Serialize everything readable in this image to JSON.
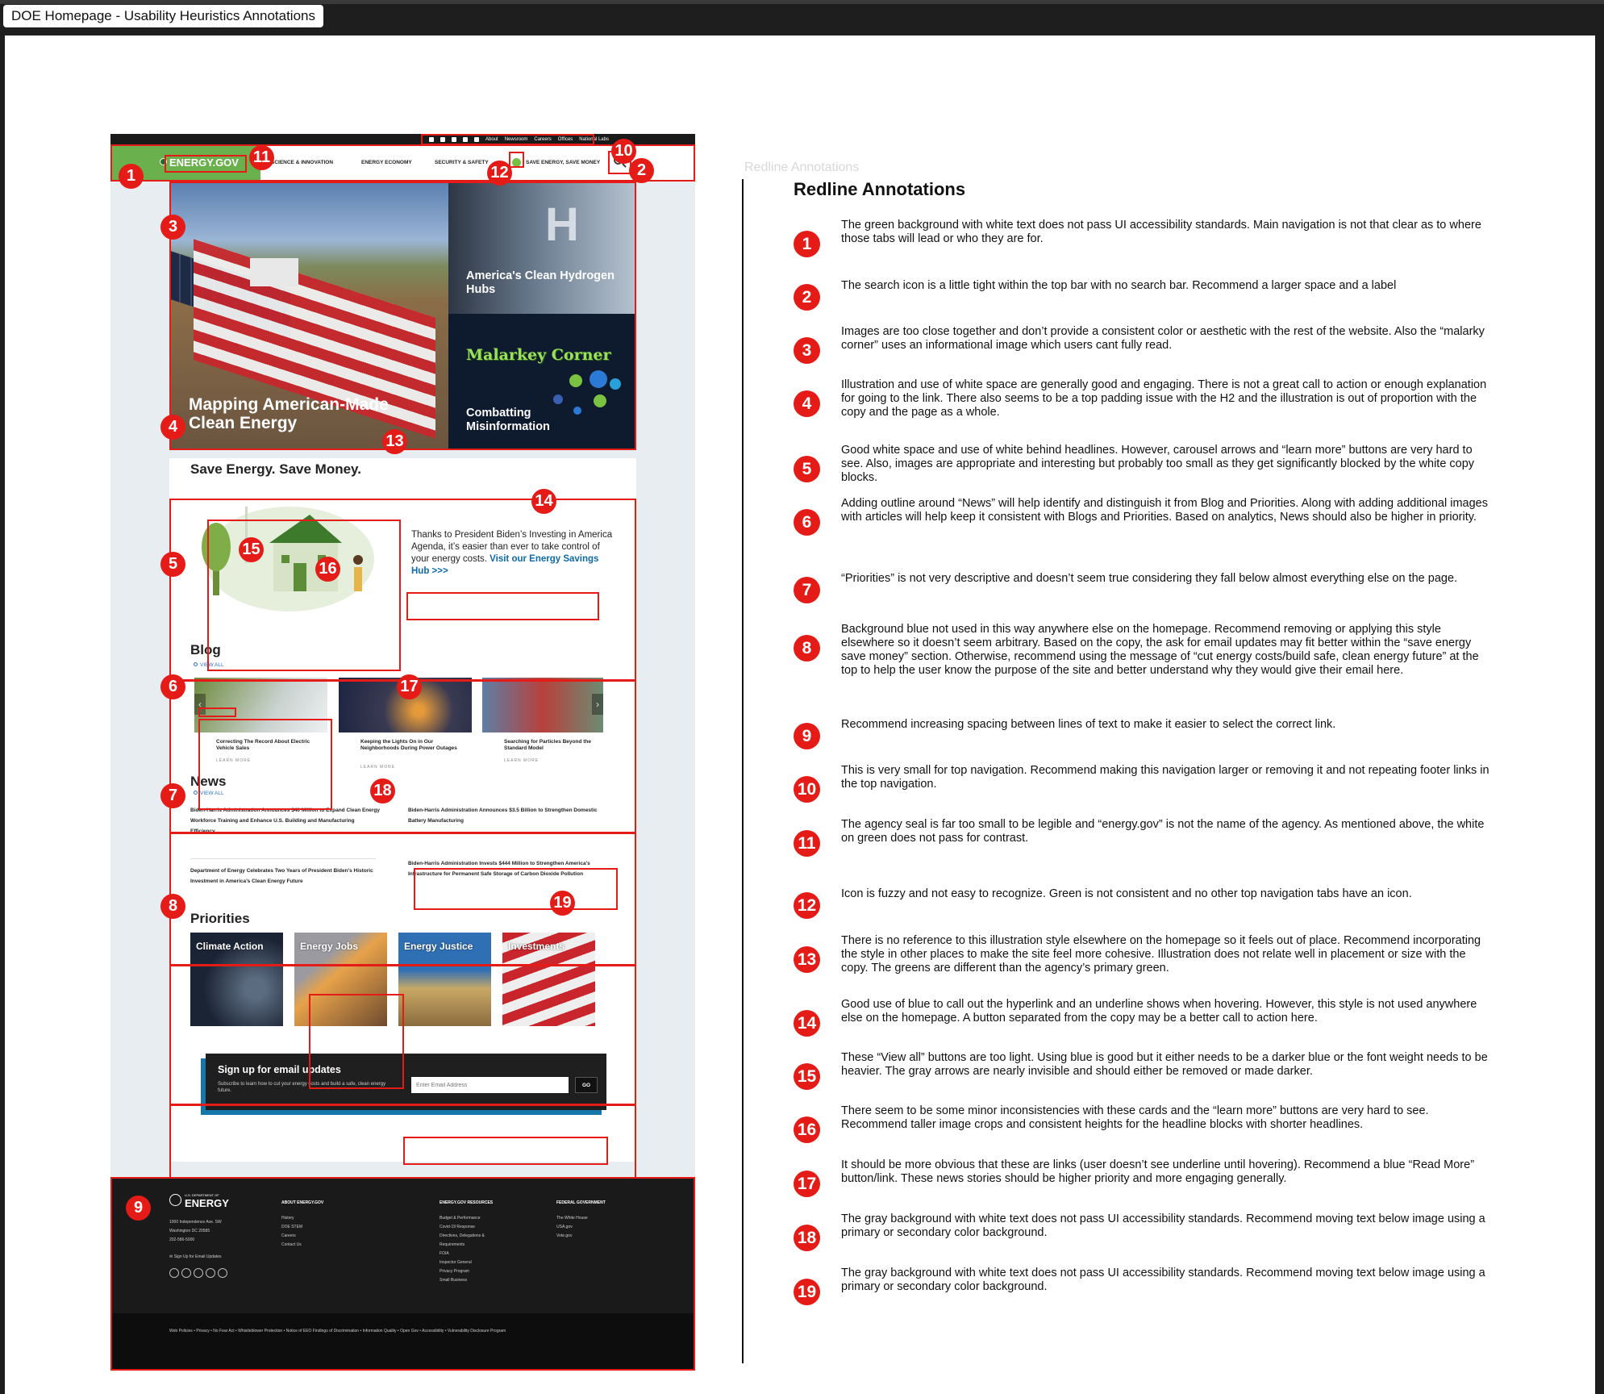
{
  "frame_title": "DOE Homepage - Usability Heuristics Annotations",
  "homepage": {
    "utility_links": [
      "About",
      "Newsroom",
      "Careers",
      "Offices",
      "National Labs"
    ],
    "social_icons": [
      "facebook-icon",
      "twitter-icon",
      "youtube-icon",
      "instagram-icon",
      "linkedin-icon"
    ],
    "logo": "ENERGY.GOV",
    "nav": [
      "SCIENCE & INNOVATION",
      "ENERGY ECONOMY",
      "SECURITY & SAFETY",
      "SAVE ENERGY, SAVE MONEY"
    ],
    "hero": {
      "main_caption": "Mapping American-Made Clean Energy",
      "h2_mark": "H",
      "h2_caption": "America's Clean Hydrogen Hubs",
      "malarkey_logo": "Malarkey Corner",
      "malarkey_caption": "Combatting Misinformation"
    },
    "save": {
      "title": "Save Energy. Save Money.",
      "text": "Thanks to President Biden’s Investing in America Agenda, it’s easier than ever to take control of your energy costs.",
      "link": "Visit our Energy Savings Hub >>>"
    },
    "blog": {
      "title": "Blog",
      "view_all": "VIEW ALL",
      "learn_more": "LEARN MORE",
      "cards": [
        {
          "title": "Correcting The Record About Electric Vehicle Sales"
        },
        {
          "title": "Keeping the Lights On in Our Neighborhoods During Power Outages"
        },
        {
          "title": "Searching for Particles Beyond the Standard Model"
        }
      ]
    },
    "news": {
      "title": "News",
      "view_all": "VIEW ALL",
      "items": [
        "Biden-Harris Administration Announces $40 Million to Expand Clean Energy Workforce Training and Enhance U.S. Building and Manufacturing Efficiency",
        "Department of Energy Celebrates Two Years of President Biden’s Historic Investment in America’s Clean Energy Future",
        "Biden-Harris Administration Announces $3.5 Billion to Strengthen Domestic Battery Manufacturing",
        "Biden-Harris Administration Invests $444 Million to Strengthen America’s Infrastructure for Permanent Safe Storage of Carbon Dioxide Pollution"
      ]
    },
    "priorities": {
      "title": "Priorities",
      "items": [
        "Climate Action",
        "Energy Jobs",
        "Energy Justice",
        "Investments"
      ]
    },
    "email": {
      "title": "Sign up for email updates",
      "subtitle": "Subscribe to learn how to cut your energy costs and build a safe, clean energy future.",
      "placeholder": "Enter Email Address",
      "button": "GO"
    },
    "footer": {
      "dept": "U.S. DEPARTMENT OF",
      "energy": "ENERGY",
      "address": [
        "1000 Independence Ave. SW",
        "Washington DC 20585",
        "202-586-5000"
      ],
      "signup": "Sign Up for Email Updates",
      "cols": [
        {
          "title": "ABOUT ENERGY.GOV",
          "items": [
            "History",
            "DOE STEM",
            "Careers",
            "Contact Us"
          ]
        },
        {
          "title": "ENERGY.GOV RESOURCES",
          "items": [
            "Budget & Performance",
            "Covid-19 Response",
            "Directives, Delegations &",
            "Requirements",
            "FOIA",
            "Inspector General",
            "Privacy Program",
            "Small Business"
          ]
        },
        {
          "title": "FEDERAL GOVERNMENT",
          "items": [
            "The White House",
            "USA.gov",
            "Vote.gov"
          ]
        }
      ],
      "legal": "Web Policies  •  Privacy  •  No Fear Act  •  Whistleblower Protection  •  Notice of EEO Findings of Discrimination  •  Information Quality  •  Open Gov  •  Accessibility  •  Vulnerability Disclosure Program"
    }
  },
  "annotations": {
    "ghost_label": "Redline Annotations",
    "title": "Redline Annotations",
    "items": [
      {
        "num": "1",
        "text": "The green background with white text does not pass UI accessibility standards. Main navigation is not that clear as to where those tabs will lead or who they are for."
      },
      {
        "num": "2",
        "text": "The search icon is a little tight within the top bar with no search bar. Recommend a larger space and a label"
      },
      {
        "num": "3",
        "text": "Images are too close together and don’t provide a consistent color or aesthetic  with the rest of the website. Also the “malarky corner” uses an informational image which users cant fully read."
      },
      {
        "num": "4",
        "text": "Illustration and use of white space are generally good and engaging. There is not a great call to action or enough explanation for going to the link. There also seems to be a top padding issue with the H2 and the illustration is out of proportion with the copy and the page as a whole."
      },
      {
        "num": "5",
        "text": "Good white space and use of white behind headlines. However, carousel arrows and “learn more” buttons are very hard to see. Also, images are appropriate and interesting but probably too small as they get significantly blocked by the white copy blocks."
      },
      {
        "num": "6",
        "text": "Adding outline around “News” will help identify and distinguish it from Blog and Priorities. Along with adding additional images with articles will help keep it consistent with Blogs and Priorities. Based on analytics, News should also be higher in priority."
      },
      {
        "num": "7",
        "text": "“Priorities” is not very descriptive and doesn’t seem true considering they fall below almost everything else on the page."
      },
      {
        "num": "8",
        "text": "Background blue not used in this way anywhere else on the homepage. Recommend removing or applying this style elsewhere so it doesn’t seem arbitrary. Based on the copy, the ask for email updates may fit better within the “save energy save money” section. Otherwise, recommend using the message of “cut energy costs/build safe, clean energy future” at the top to help the user know the purpose of the site and better understand why they would give their email here."
      },
      {
        "num": "9",
        "text": "Recommend increasing spacing between lines of text to make it easier to select the correct link."
      },
      {
        "num": "10",
        "text": "This is very small for top navigation. Recommend making this navigation larger or removing it and not repeating footer links in the top navigation."
      },
      {
        "num": "11",
        "text": "The agency seal is far too small to be legible and “energy.gov” is not the name of the agency. As mentioned above, the white on green does not pass for contrast."
      },
      {
        "num": "12",
        "text": "Icon is fuzzy and not easy to recognize. Green is not consistent and no other top navigation tabs have an icon."
      },
      {
        "num": "13",
        "text": "There is no reference to this illustration style elsewhere on the homepage so it feels out of place. Recommend incorporating the style in other places to make the site feel more cohesive. Illustration does not relate well in placement or size with the copy. The greens are different than the agency’s primary green."
      },
      {
        "num": "14",
        "text": "Good use of blue to call out the hyperlink and an underline shows when hovering. However, this style is not used anywhere else on the homepage. A button separated from the copy may be a better call to action here."
      },
      {
        "num": "15",
        "text": "These “View all” buttons are too light. Using blue is good but it either needs to be a darker blue or the font weight needs to be heavier. The gray arrows are nearly invisible and should either be removed or made darker."
      },
      {
        "num": "16",
        "text": "There seem to be some minor inconsistencies with these cards and the “learn more” buttons are very hard to see. Recommend taller image crops and consistent heights for the headline blocks with shorter headlines."
      },
      {
        "num": "17",
        "text": "It should be more obvious that these are links (user doesn’t see underline until hovering). Recommend a blue “Read More” button/link. These news stories should be higher priority and more engaging generally."
      },
      {
        "num": "18",
        "text": "The gray background with white text does not pass UI accessibility standards. Recommend moving text below image using a primary or secondary color background."
      },
      {
        "num": "19",
        "text": "The gray background with white text does not pass UI accessibility standards. Recommend moving text below image using a primary or secondary color background."
      }
    ]
  }
}
